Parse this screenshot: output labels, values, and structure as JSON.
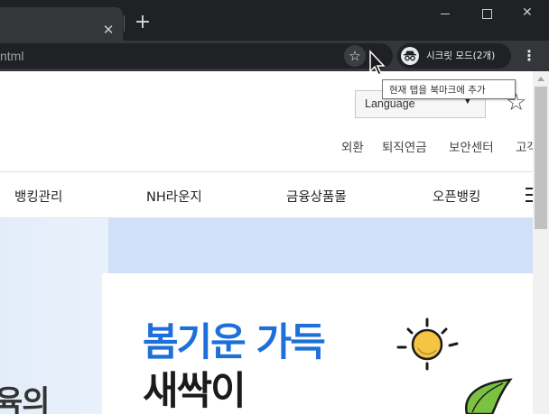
{
  "browser": {
    "tab_close_glyph": "✕",
    "new_tab_glyph": "+",
    "url_fragment": "ntml",
    "bookmark_star_glyph": "☆",
    "incognito_label": "시크릿 모드(2개)",
    "menu_glyph": "⋮",
    "window_close_glyph": "✕",
    "tooltip": "현재 탭을 북마크에 추가",
    "icons": [
      "close-icon",
      "plus-icon",
      "star-icon",
      "incognito-icon",
      "more-vert-icon",
      "minimize-icon",
      "maximize-icon"
    ]
  },
  "site": {
    "language": {
      "label": "Language",
      "caret": "▼"
    },
    "favorite_glyph": "☆",
    "util_links": [
      "외환",
      "퇴직연금",
      "보안센터",
      "고객"
    ],
    "gnb": [
      "뱅킹관리",
      "NH라운지",
      "금융상품몰",
      "오픈뱅킹"
    ],
    "banner": {
      "partial_text": "육의",
      "headline_1": "봄기운 가득",
      "headline_2": "새싹이"
    }
  },
  "colors": {
    "tabstrip": "#202124",
    "toolbar": "#35363a",
    "accent_blue": "#1e6fd9",
    "banner_strip": "#cfe0f8",
    "sun_yellow": "#f5c443",
    "leaf_green": "#7cc242"
  }
}
